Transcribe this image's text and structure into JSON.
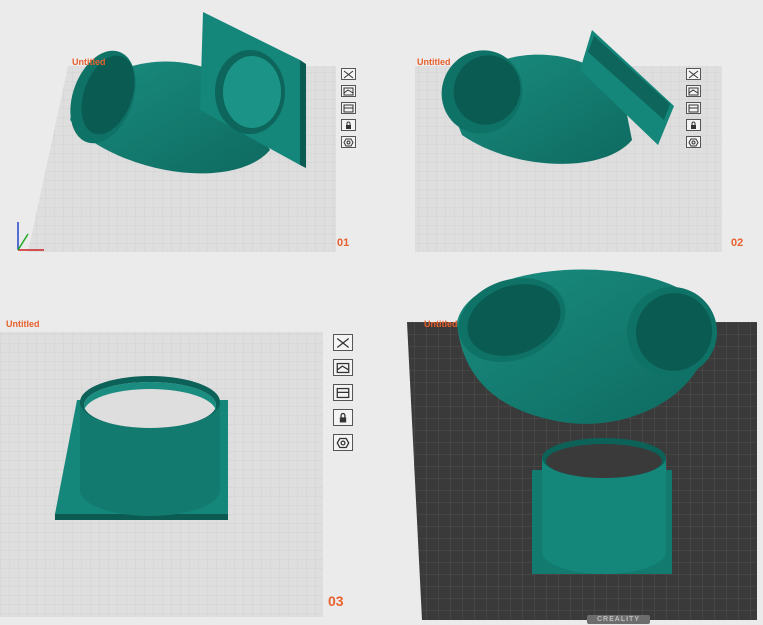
{
  "panels": [
    {
      "title": "Untitled",
      "number": "01"
    },
    {
      "title": "Untitled",
      "number": "02"
    },
    {
      "title": "Untitled",
      "number": "03"
    },
    {
      "title": "Untitled"
    }
  ],
  "toolbar_icons": [
    "close-icon",
    "layout-icon",
    "panels-icon",
    "lock-icon",
    "settings-icon"
  ],
  "bed_brand": "CREALITY",
  "colors": {
    "model": "#127a6f",
    "model_dark": "#0b5b52",
    "accent": "#e8602c",
    "bed_light": "#dcdcdc",
    "bed_dark": "#3a3a3a"
  }
}
